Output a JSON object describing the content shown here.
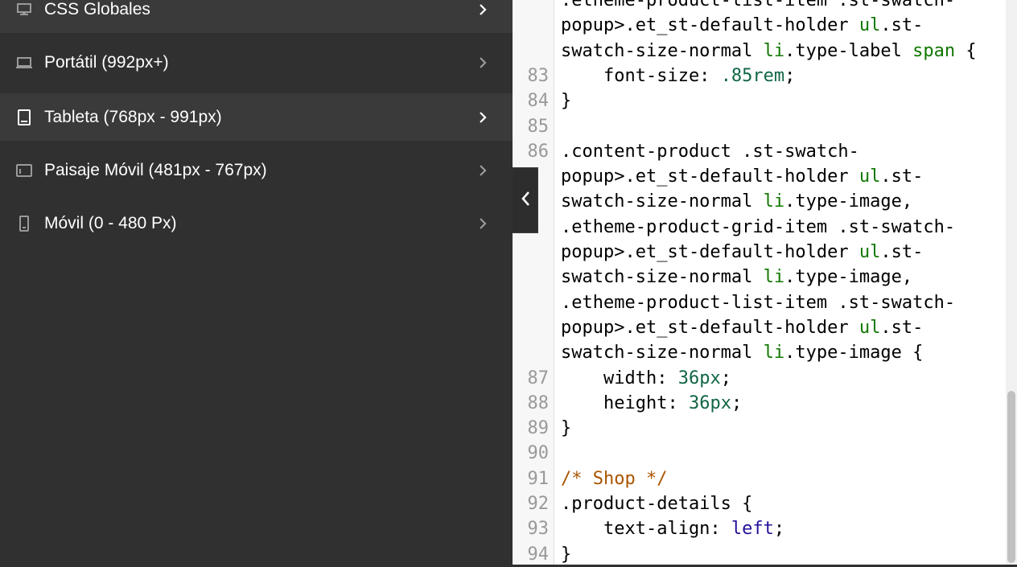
{
  "sidebar": {
    "items": [
      {
        "label": "CSS Globales",
        "icon": "desktop-icon",
        "active": true
      },
      {
        "label": "Portátil (992px+)",
        "icon": "laptop-icon",
        "active": false
      },
      {
        "label": "Tableta (768px - 991px)",
        "icon": "tablet-icon",
        "active": true
      },
      {
        "label": "Paisaje Móvil (481px - 767px)",
        "icon": "tablet-landscape-icon",
        "active": false
      },
      {
        "label": "Móvil (0 - 480 Px)",
        "icon": "mobile-icon",
        "active": false
      }
    ]
  },
  "editor": {
    "lines": [
      {
        "num": "",
        "parts": [
          {
            "t": ".etheme-product-list-item .st-swatch-",
            "c": "t-sel"
          }
        ]
      },
      {
        "num": "",
        "parts": [
          {
            "t": "popup>.et_st-default-holder ",
            "c": "t-sel"
          },
          {
            "t": "ul",
            "c": "t-tag"
          },
          {
            "t": ".st-",
            "c": "t-sel"
          }
        ]
      },
      {
        "num": "",
        "parts": [
          {
            "t": "swatch-size-normal ",
            "c": "t-sel"
          },
          {
            "t": "li",
            "c": "t-tag"
          },
          {
            "t": ".type-label ",
            "c": "t-sel"
          },
          {
            "t": "span",
            "c": "t-tag"
          },
          {
            "t": " {",
            "c": "t-sel"
          }
        ]
      },
      {
        "num": "83",
        "parts": [
          {
            "t": "    font-size: ",
            "c": "t-sel"
          },
          {
            "t": ".85rem",
            "c": "t-num"
          },
          {
            "t": ";",
            "c": "t-sel"
          }
        ]
      },
      {
        "num": "84",
        "parts": [
          {
            "t": "}",
            "c": "t-sel"
          }
        ]
      },
      {
        "num": "85",
        "parts": []
      },
      {
        "num": "86",
        "parts": [
          {
            "t": ".content-product .st-swatch-",
            "c": "t-sel"
          }
        ]
      },
      {
        "num": "",
        "parts": [
          {
            "t": "popup>.et_st-default-holder ",
            "c": "t-sel"
          },
          {
            "t": "ul",
            "c": "t-tag"
          },
          {
            "t": ".st-",
            "c": "t-sel"
          }
        ]
      },
      {
        "num": "",
        "parts": [
          {
            "t": "swatch-size-normal ",
            "c": "t-sel"
          },
          {
            "t": "li",
            "c": "t-tag"
          },
          {
            "t": ".type-image,",
            "c": "t-sel"
          }
        ]
      },
      {
        "num": "",
        "parts": [
          {
            "t": ".etheme-product-grid-item .st-swatch-",
            "c": "t-sel"
          }
        ]
      },
      {
        "num": "",
        "parts": [
          {
            "t": "popup>.et_st-default-holder ",
            "c": "t-sel"
          },
          {
            "t": "ul",
            "c": "t-tag"
          },
          {
            "t": ".st-",
            "c": "t-sel"
          }
        ]
      },
      {
        "num": "",
        "parts": [
          {
            "t": "swatch-size-normal ",
            "c": "t-sel"
          },
          {
            "t": "li",
            "c": "t-tag"
          },
          {
            "t": ".type-image,",
            "c": "t-sel"
          }
        ]
      },
      {
        "num": "",
        "parts": [
          {
            "t": ".etheme-product-list-item .st-swatch-",
            "c": "t-sel"
          }
        ]
      },
      {
        "num": "",
        "parts": [
          {
            "t": "popup>.et_st-default-holder ",
            "c": "t-sel"
          },
          {
            "t": "ul",
            "c": "t-tag"
          },
          {
            "t": ".st-",
            "c": "t-sel"
          }
        ]
      },
      {
        "num": "",
        "parts": [
          {
            "t": "swatch-size-normal ",
            "c": "t-sel"
          },
          {
            "t": "li",
            "c": "t-tag"
          },
          {
            "t": ".type-image {",
            "c": "t-sel"
          }
        ]
      },
      {
        "num": "87",
        "parts": [
          {
            "t": "    width: ",
            "c": "t-sel"
          },
          {
            "t": "36px",
            "c": "t-num"
          },
          {
            "t": ";",
            "c": "t-sel"
          }
        ]
      },
      {
        "num": "88",
        "parts": [
          {
            "t": "    height: ",
            "c": "t-sel"
          },
          {
            "t": "36px",
            "c": "t-num"
          },
          {
            "t": ";",
            "c": "t-sel"
          }
        ]
      },
      {
        "num": "89",
        "parts": [
          {
            "t": "}",
            "c": "t-sel"
          }
        ]
      },
      {
        "num": "90",
        "parts": []
      },
      {
        "num": "91",
        "parts": [
          {
            "t": "/* Shop */",
            "c": "t-cmt"
          }
        ]
      },
      {
        "num": "92",
        "parts": [
          {
            "t": ".product-details {",
            "c": "t-sel"
          }
        ]
      },
      {
        "num": "93",
        "parts": [
          {
            "t": "    text-align: ",
            "c": "t-sel"
          },
          {
            "t": "left",
            "c": "t-kw"
          },
          {
            "t": ";",
            "c": "t-sel"
          }
        ]
      },
      {
        "num": "94",
        "parts": [
          {
            "t": "}",
            "c": "t-sel"
          }
        ]
      }
    ]
  },
  "colors": {
    "sidebar_bg": "#303030",
    "active_bg": "#3a3a3a",
    "tag": "#117700",
    "number": "#116644",
    "keyword": "#221199",
    "comment": "#aa5500"
  }
}
